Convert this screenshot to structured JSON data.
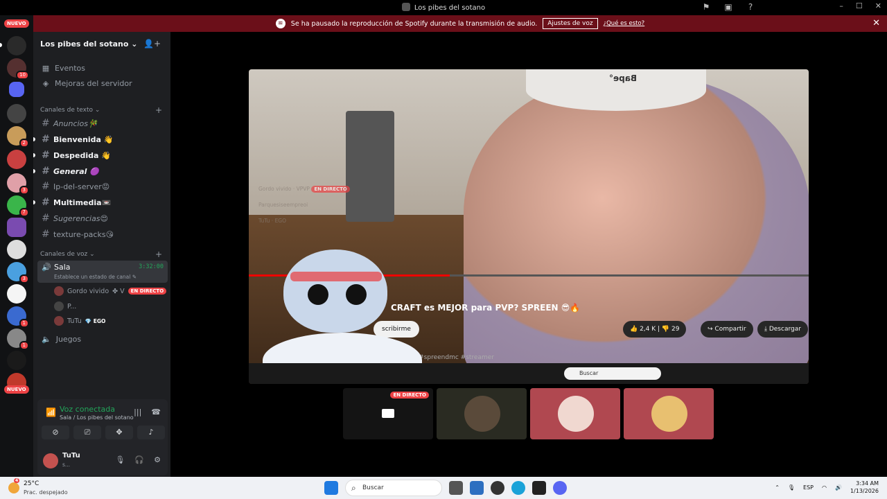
{
  "window": {
    "title": "Los pibes del sotano",
    "controls": [
      "–",
      "☐",
      "✕"
    ]
  },
  "notice": {
    "text": "Se ha pausado la reproducción de Spotify durante la transmisión de audio.",
    "button": "Ajustes de voz",
    "link": "¿Qué es esto?"
  },
  "servers": {
    "nuevo_top": "NUEVO",
    "nuevo_bottom": "NUEVO",
    "badges": [
      "10",
      "2",
      "3",
      "7",
      "3",
      "1",
      "1"
    ]
  },
  "sidebar": {
    "server_name": "Los pibes del sotano",
    "menu": [
      "Eventos",
      "Mejoras del servidor"
    ],
    "text_category": "Canales de texto",
    "text_channels": [
      {
        "label": "Anuncios🎋"
      },
      {
        "label": "Bienvenida 👋"
      },
      {
        "label": "Despedida 👋"
      },
      {
        "label": "General 🟣"
      },
      {
        "label": "Ip-del-server😡"
      },
      {
        "label": "Multimedia📼"
      },
      {
        "label": "Sugerencias😍"
      },
      {
        "label": "texture-packs😘"
      }
    ],
    "voice_category": "Canales de voz",
    "voice_channel": {
      "name": "Sala",
      "timer": "3:32:00",
      "status": "Establece un estado de canal"
    },
    "voice_users": [
      {
        "name": "Gordo vivido",
        "live": "EN DIRECTO"
      },
      {
        "name": "P..."
      },
      {
        "name": "TuTu",
        "tag": "EGO"
      }
    ],
    "second_voice": "Juegos"
  },
  "voice_panel": {
    "title": "Voz conectada",
    "subtitle": "Sala / Los pibes del sotano"
  },
  "user": {
    "name": "TuTu",
    "status": "s..."
  },
  "stream": {
    "video_title": "CRAFT es MEJOR para PVP? SPREEN 😎🔥",
    "subscribe": "scribirme",
    "likes": "2,4 K",
    "dislikes": "29",
    "share": "Compartir",
    "download": "Descargar",
    "tags": "reen #spreendmc #streamer",
    "beanie": "Bape°",
    "taskbar_search": "Buscar",
    "ghost_users": [
      {
        "name": "Gordo vivido",
        "extra": "VPVP",
        "live": "EN DIRECTO"
      },
      {
        "name": "Parquesiseempreoi",
        "extra": ""
      },
      {
        "name": "TuTu",
        "extra": "EGO"
      }
    ]
  },
  "thumbnails": [
    {
      "live": "EN DIRECTO"
    },
    {},
    {},
    {}
  ],
  "taskbar": {
    "temp": "25°C",
    "weather": "Prac. despejado",
    "weather_badge": "4",
    "search": "Buscar",
    "lang": "ESP",
    "time": "3:34 AM",
    "date": "1/13/2026"
  },
  "colors": {
    "notice_bg": "#6b0f19",
    "live": "#ed4245",
    "voice_green": "#23a55a"
  }
}
